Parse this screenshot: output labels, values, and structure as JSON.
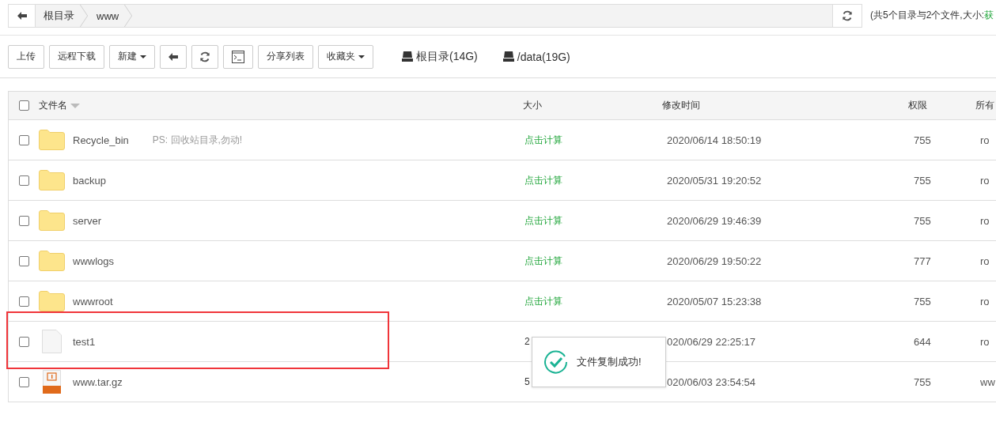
{
  "breadcrumb": {
    "items": [
      {
        "label": "根目录"
      },
      {
        "label": "www"
      }
    ]
  },
  "summary": {
    "text": "(共5个目录与2个文件,大小:",
    "link": "获"
  },
  "toolbar": {
    "buttons": [
      {
        "kind": "text",
        "label": "上传",
        "dropdown": false
      },
      {
        "kind": "text",
        "label": "远程下载",
        "dropdown": false
      },
      {
        "kind": "text",
        "label": "新建",
        "dropdown": true
      },
      {
        "kind": "back"
      },
      {
        "kind": "refresh"
      },
      {
        "kind": "terminal"
      },
      {
        "kind": "text",
        "label": "分享列表",
        "dropdown": false
      },
      {
        "kind": "text",
        "label": "收藏夹",
        "dropdown": true
      }
    ],
    "disks": [
      {
        "label": "根目录(14G)"
      },
      {
        "label": "/data(19G)"
      }
    ]
  },
  "table": {
    "select_all": {
      "checked": false
    },
    "columns": [
      {
        "label": "文件名",
        "sortable": true
      },
      {
        "label": "大小",
        "sortable": false
      },
      {
        "label": "修改时间",
        "sortable": false
      },
      {
        "label": "权限",
        "sortable": false
      },
      {
        "label": "所有",
        "sortable": false
      }
    ],
    "rows": [
      {
        "kind": "folder",
        "checked": false,
        "name": "Recycle_bin",
        "note": "PS: 回收站目录,勿动!",
        "size": "点击计算",
        "size_link": true,
        "modified": "2020/06/14 18:50:19",
        "permission": "755",
        "owner": "ro"
      },
      {
        "kind": "folder",
        "checked": false,
        "name": "backup",
        "size": "点击计算",
        "size_link": true,
        "modified": "2020/05/31 19:20:52",
        "permission": "755",
        "owner": "ro"
      },
      {
        "kind": "folder",
        "checked": false,
        "name": "server",
        "size": "点击计算",
        "size_link": true,
        "modified": "2020/06/29 19:46:39",
        "permission": "755",
        "owner": "ro"
      },
      {
        "kind": "folder",
        "checked": false,
        "name": "wwwlogs",
        "size": "点击计算",
        "size_link": true,
        "modified": "2020/06/29 19:50:22",
        "permission": "777",
        "owner": "ro"
      },
      {
        "kind": "folder",
        "checked": false,
        "name": "wwwroot",
        "size": "点击计算",
        "size_link": true,
        "modified": "2020/05/07 15:23:38",
        "permission": "755",
        "owner": "ro"
      },
      {
        "kind": "file",
        "checked": false,
        "name": "test1",
        "size": "2",
        "size_link": false,
        "modified": "020/06/29 22:25:17",
        "permission": "644",
        "owner": "ro"
      },
      {
        "kind": "archive",
        "checked": false,
        "name": "www.tar.gz",
        "size": "5",
        "size_link": false,
        "modified": "020/06/03 23:54:54",
        "permission": "755",
        "owner": "ww"
      }
    ]
  },
  "toast": {
    "message": "文件复制成功!"
  }
}
